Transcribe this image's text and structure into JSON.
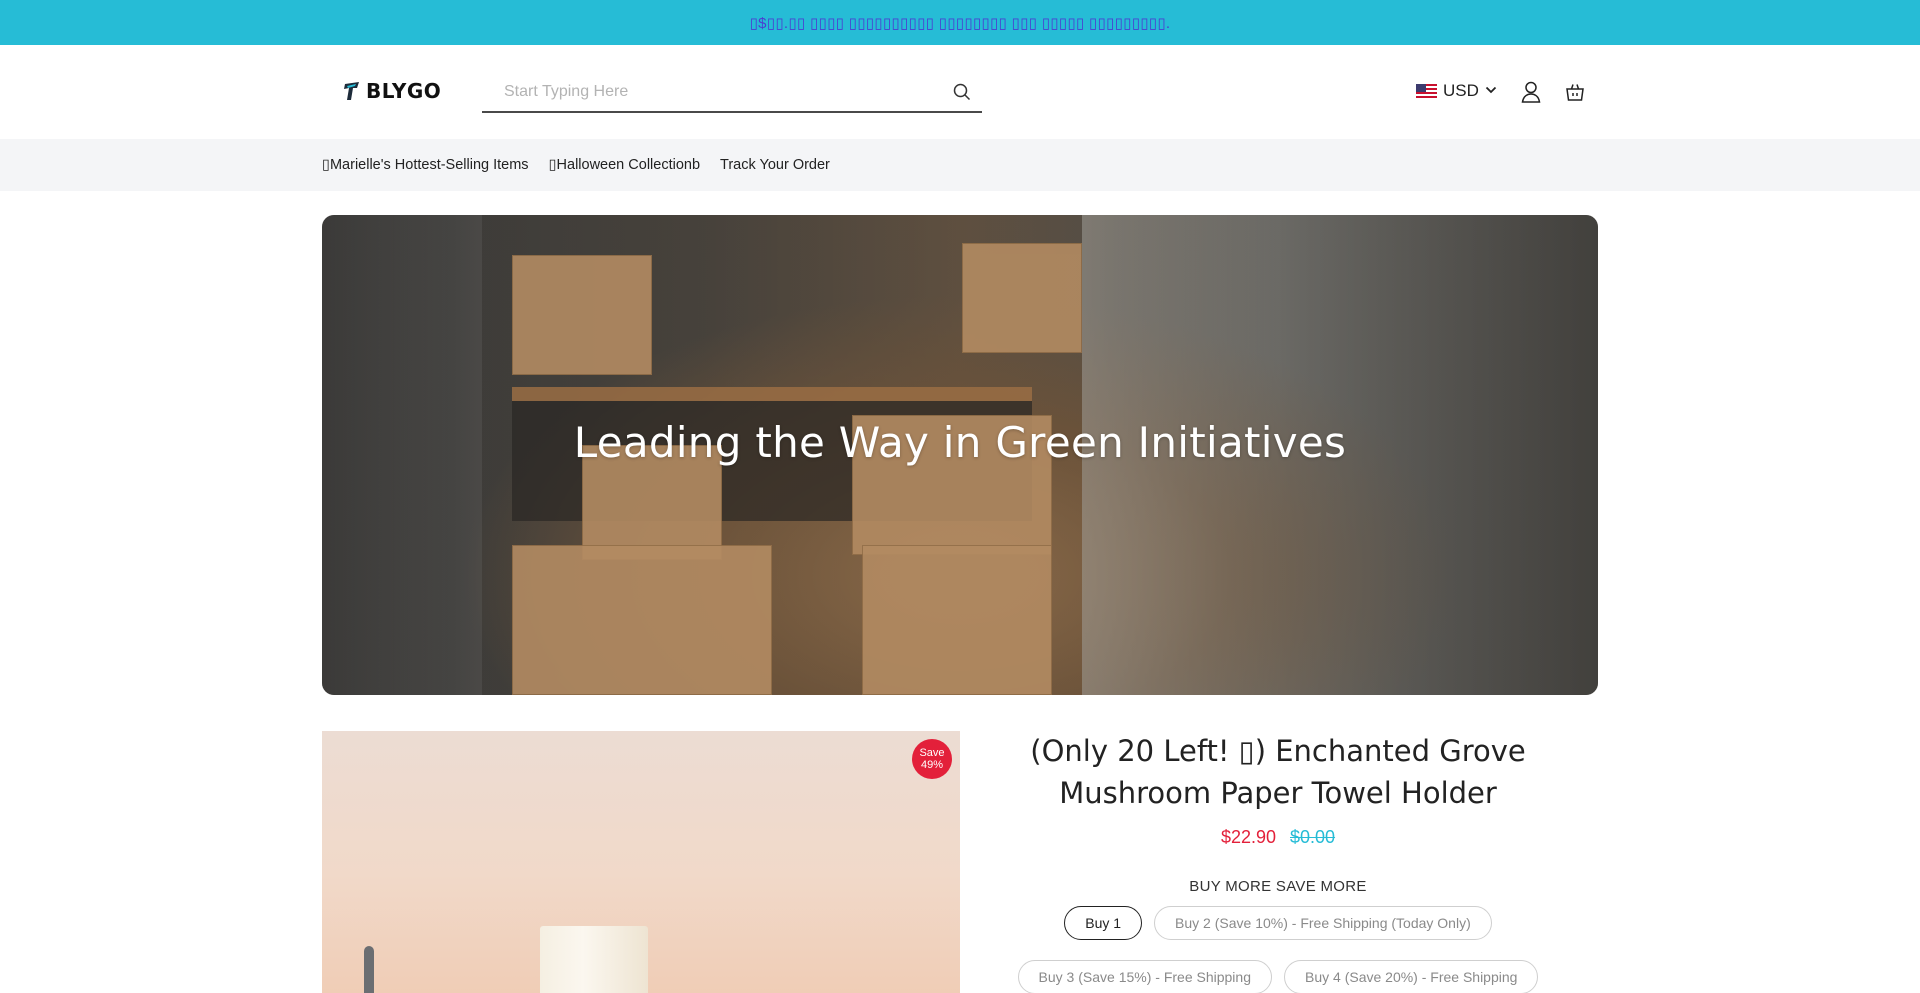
{
  "announcement": {
    "text": "▯$▯▯.▯▯ ▯▯▯▯ ▯▯▯▯▯▯▯▯▯▯ ▯▯▯▯▯▯▯▯ ▯▯▯ ▯▯▯▯▯ ▯▯▯▯▯▯▯▯▯."
  },
  "header": {
    "logo_text": "BLYGO",
    "search_placeholder": "Start Typing Here",
    "currency": "USD",
    "icons": [
      "search-icon",
      "chevron-down-icon",
      "user-icon",
      "cart-icon"
    ]
  },
  "nav": {
    "items": [
      {
        "label": "▯Marielle's Hottest-Selling Items"
      },
      {
        "label": "▯Halloween Collectionb"
      },
      {
        "label": "Track Your Order"
      }
    ]
  },
  "hero": {
    "title": "Leading the Way in Green Initiatives"
  },
  "product": {
    "badge_line1": "Save",
    "badge_line2": "49%",
    "title": "(Only 20 Left! ▯) Enchanted Grove Mushroom Paper Towel Holder",
    "price": "$22.90",
    "compare_price": "$0.00",
    "bundle_label": "BUY MORE SAVE MORE",
    "bundles": [
      {
        "label": "Buy 1",
        "selected": true
      },
      {
        "label": "Buy 2 (Save 10%) - Free Shipping (Today Only)",
        "selected": false
      },
      {
        "label": "Buy 3 (Save 15%) - Free Shipping",
        "selected": false
      },
      {
        "label": "Buy 4 (Save 20%) - Free Shipping",
        "selected": false
      }
    ]
  },
  "colors": {
    "announcement_bg": "#26bcd6",
    "announcement_text": "#4a3fd1",
    "sale_price": "#e3203a",
    "compare_price": "#26bcd6",
    "nav_bg": "#f4f5f7"
  }
}
